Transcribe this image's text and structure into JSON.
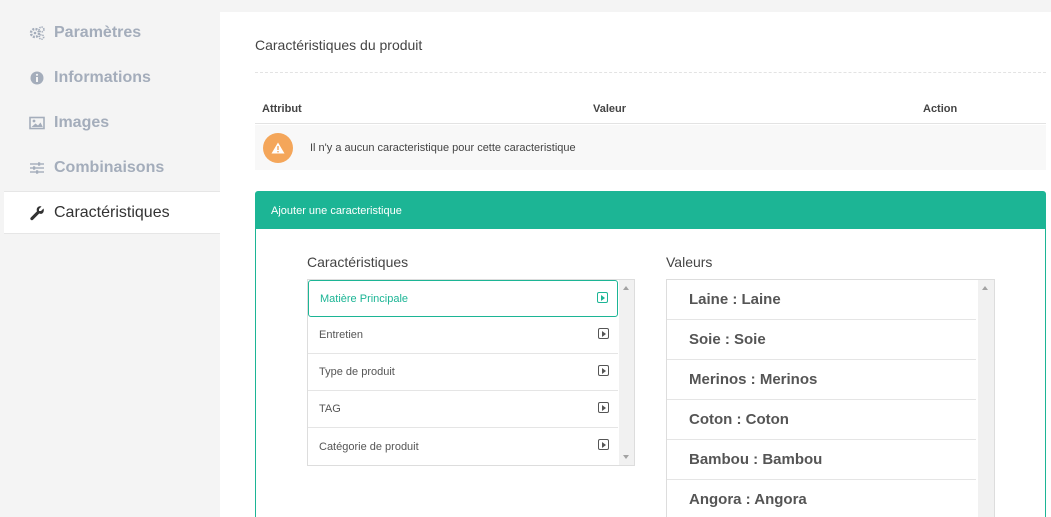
{
  "sidebar": {
    "items": [
      {
        "label": "Paramètres",
        "icon": "gears-icon"
      },
      {
        "label": "Informations",
        "icon": "info-icon"
      },
      {
        "label": "Images",
        "icon": "image-icon"
      },
      {
        "label": "Combinaisons",
        "icon": "sliders-icon"
      },
      {
        "label": "Caractéristiques",
        "icon": "wrench-icon",
        "active": true
      }
    ]
  },
  "main": {
    "title": "Caractéristiques du produit",
    "table": {
      "headers": [
        "Attribut",
        "Valeur",
        "Action"
      ],
      "empty_message": "Il n'y a aucun caracteristique pour cette caracteristique"
    },
    "panel": {
      "title": "Ajouter une caracteristique",
      "features_label": "Caractéristiques",
      "values_label": "Valeurs",
      "features": [
        {
          "label": "Matière Principale",
          "active": true
        },
        {
          "label": "Entretien"
        },
        {
          "label": "Type de produit"
        },
        {
          "label": "TAG"
        },
        {
          "label": "Catégorie de produit"
        }
      ],
      "values": [
        "Laine :  Laine",
        "Soie :  Soie",
        "Merinos :  Merinos",
        "Coton :  Coton",
        "Bambou :  Bambou",
        "Angora :  Angora"
      ]
    }
  },
  "colors": {
    "accent": "#1cb595",
    "warning": "#f4a65a",
    "sidebar_text": "#a4adbb"
  }
}
